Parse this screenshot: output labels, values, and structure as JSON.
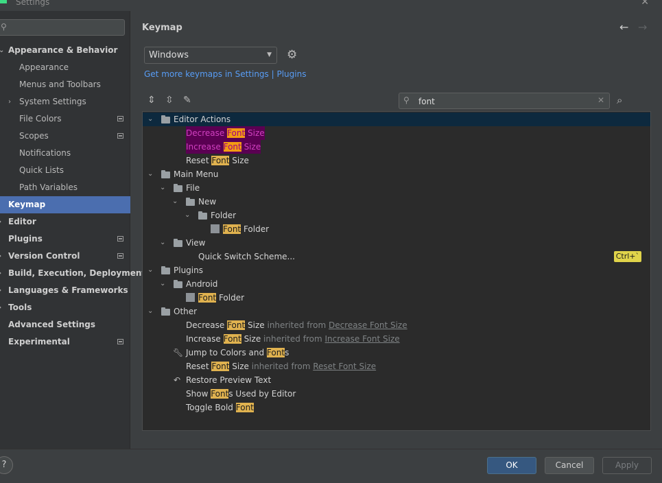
{
  "window": {
    "title": "Settings"
  },
  "sidebar": {
    "search_placeholder": "",
    "items": [
      {
        "label": "Appearance & Behavior",
        "level": "top",
        "expanded": true
      },
      {
        "label": "Appearance",
        "level": "sub"
      },
      {
        "label": "Menus and Toolbars",
        "level": "sub"
      },
      {
        "label": "System Settings",
        "level": "sub",
        "collapsed": true
      },
      {
        "label": "File Colors",
        "level": "sub",
        "marker": true
      },
      {
        "label": "Scopes",
        "level": "sub",
        "marker": true
      },
      {
        "label": "Notifications",
        "level": "sub"
      },
      {
        "label": "Quick Lists",
        "level": "sub"
      },
      {
        "label": "Path Variables",
        "level": "sub"
      },
      {
        "label": "Keymap",
        "level": "top",
        "selected": true
      },
      {
        "label": "Editor",
        "level": "top"
      },
      {
        "label": "Plugins",
        "level": "top",
        "marker": true
      },
      {
        "label": "Version Control",
        "level": "top",
        "marker": true
      },
      {
        "label": "Build, Execution, Deployment",
        "level": "top"
      },
      {
        "label": "Languages & Frameworks",
        "level": "top"
      },
      {
        "label": "Tools",
        "level": "top"
      },
      {
        "label": "Advanced Settings",
        "level": "top"
      },
      {
        "label": "Experimental",
        "level": "top",
        "marker": true
      }
    ]
  },
  "main": {
    "title": "Keymap",
    "keymap_selected": "Windows",
    "more_keymaps_link": "Get more keymaps in Settings | Plugins",
    "filter_value": "font"
  },
  "tree": {
    "editor_actions": "Editor Actions",
    "decrease_a": "Decrease ",
    "decrease_b": "Font",
    "decrease_c": " Size",
    "increase_a": "Increase ",
    "increase_b": "Font",
    "increase_c": " Size",
    "reset_a": "Reset ",
    "reset_b": "Font",
    "reset_c": " Size",
    "main_menu": "Main Menu",
    "file": "File",
    "new": "New",
    "folder": "Folder",
    "font_folder_a": "Font",
    "font_folder_b": " Folder",
    "view": "View",
    "quick_switch": "Quick Switch Scheme...",
    "quick_switch_shortcut": "Ctrl+`",
    "plugins": "Plugins",
    "android": "Android",
    "android_font_folder_a": "Font",
    "android_font_folder_b": " Folder",
    "other": "Other",
    "o_decrease_a": "Decrease ",
    "o_decrease_b": "Font",
    "o_decrease_c": " Size",
    "o_decrease_inh": " inherited from ",
    "o_decrease_link": "Decrease Font Size",
    "o_increase_a": "Increase ",
    "o_increase_b": "Font",
    "o_increase_c": " Size",
    "o_increase_inh": " inherited from ",
    "o_increase_link": "Increase Font Size",
    "jump_a": "Jump to Colors and ",
    "jump_b": "Font",
    "jump_c": "s",
    "o_reset_a": "Reset ",
    "o_reset_b": "Font",
    "o_reset_c": " Size",
    "o_reset_inh": " inherited from ",
    "o_reset_link": "Reset Font Size",
    "restore": "Restore Preview Text",
    "show_a": "Show ",
    "show_b": "Font",
    "show_c": "s Used by Editor",
    "toggle_a": "Toggle Bold ",
    "toggle_b": "Font"
  },
  "buttons": {
    "help": "?",
    "ok": "OK",
    "cancel": "Cancel",
    "apply": "Apply"
  },
  "colors": {
    "accent": "#4b6eaf",
    "highlight": "#e0b24f",
    "link": "#589df6"
  }
}
